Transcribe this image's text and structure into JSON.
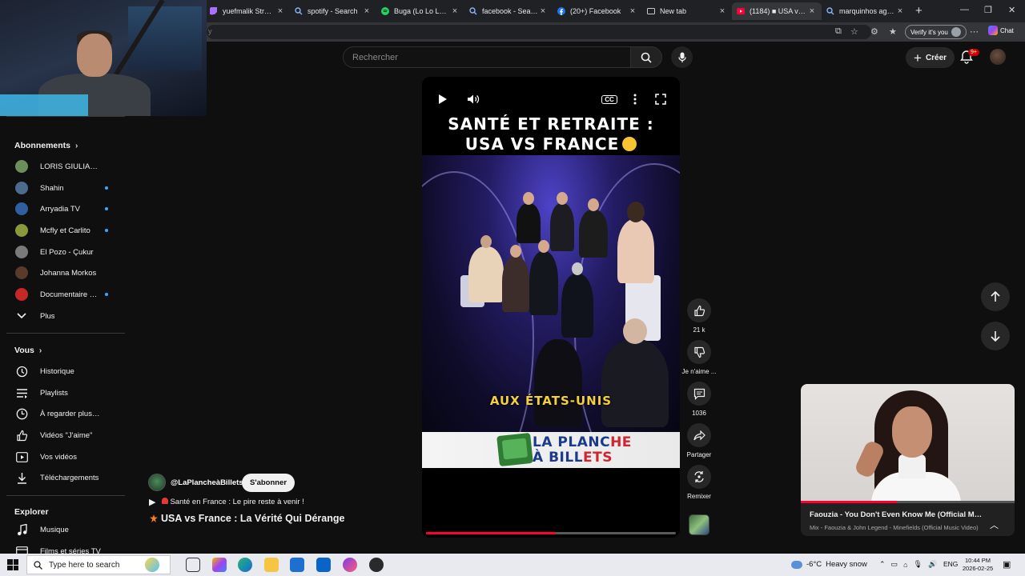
{
  "browser": {
    "tabs": [
      {
        "title": "yuefmalik Stream - V",
        "icon": "twitch-icon",
        "color": "#a970ff",
        "active": false
      },
      {
        "title": "spotify - Search",
        "icon": "search-icon",
        "color": "#8ab4f8",
        "active": false
      },
      {
        "title": "Buga (Lo Lo Lo) - sc",
        "icon": "spotify-icon",
        "color": "#1ed760",
        "active": false
      },
      {
        "title": "facebook - Search",
        "icon": "search-icon",
        "color": "#8ab4f8",
        "active": false
      },
      {
        "title": "(20+) Facebook",
        "icon": "facebook-icon",
        "color": "#1877f2",
        "active": false
      },
      {
        "title": "New tab",
        "icon": "newtab-icon",
        "color": "#c9c9c9",
        "active": false
      },
      {
        "title": "(1184) ■ USA vs Fr",
        "icon": "youtube-icon",
        "color": "#ff0033",
        "active": true
      },
      {
        "title": "marquinhos age - Se",
        "icon": "search-icon",
        "color": "#8ab4f8",
        "active": false
      }
    ],
    "address_fragment": "y",
    "verify_label": "Verify it's you",
    "chat_label": "Chat"
  },
  "youtube": {
    "search_placeholder": "Rechercher",
    "create_label": "Créer",
    "notification_count": "9+"
  },
  "sidebar": {
    "subscriptions_header": "Abonnements",
    "subscriptions": [
      {
        "label": "LORIS GIULIANO",
        "avatar_color": "#6b8f5a",
        "new": false
      },
      {
        "label": "Shahin",
        "avatar_color": "#4b6b8f",
        "new": true
      },
      {
        "label": "Arryadia TV",
        "avatar_color": "#2f5f9e",
        "new": true
      },
      {
        "label": "Mcfly et Carlito",
        "avatar_color": "#8a9a3a",
        "new": true
      },
      {
        "label": "El Pozo - Çukur",
        "avatar_color": "#7a7a7a",
        "new": false
      },
      {
        "label": "Johanna Morkos",
        "avatar_color": "#5a3a2a",
        "new": false
      },
      {
        "label": "Documentaire S...",
        "avatar_color": "#c62828",
        "new": true
      }
    ],
    "more_label": "Plus",
    "you_header": "Vous",
    "you_items": [
      {
        "label": "Historique",
        "icon": "history-icon"
      },
      {
        "label": "Playlists",
        "icon": "playlist-icon"
      },
      {
        "label": "À regarder plus tard",
        "icon": "watch-later-icon"
      },
      {
        "label": "Vidéos \"J'aime\"",
        "icon": "liked-icon"
      },
      {
        "label": "Vos vidéos",
        "icon": "your-videos-icon"
      },
      {
        "label": "Téléchargements",
        "icon": "download-icon"
      }
    ],
    "explore_header": "Explorer",
    "explore_items": [
      {
        "label": "Musique",
        "icon": "music-icon"
      },
      {
        "label": "Films et séries TV",
        "icon": "movies-icon"
      }
    ]
  },
  "short": {
    "overlay_title_line1": "SANTÉ ET RETRAITE :",
    "overlay_title_line2": "USA VS FRANCE",
    "caption": "AUX ÉTATS-UNIS",
    "banner_line1_main": "LA PLANC",
    "banner_line1_accent": "HE",
    "banner_line2_main": "À BILL",
    "banner_line2_accent": "ETS",
    "progress_fraction": 0.52,
    "channel_handle": "@LaPlancheàBillets",
    "subscribe_label": "S'abonner",
    "subline_text": "Santé en France : Le pire reste à venir !",
    "title": "USA vs France : La Vérité Qui Dérange"
  },
  "actions": {
    "likes": "21 k",
    "dislike_label": "Je n'aime ...",
    "comments": "1036",
    "share_label": "Partager",
    "remix_label": "Remixer"
  },
  "miniplayer": {
    "title": "Faouzia - You Don't Even Know Me (Official Music Video)",
    "subtitle": "Mix - Faouzia & John Legend - Minefields (Official Music Video)",
    "progress_fraction": 0.45
  },
  "taskbar": {
    "search_placeholder": "Type here to search",
    "weather_temp": "-6°C",
    "weather_desc": "Heavy snow",
    "language": "ENG",
    "time": "10:44 PM",
    "date": "2026-02-25"
  }
}
